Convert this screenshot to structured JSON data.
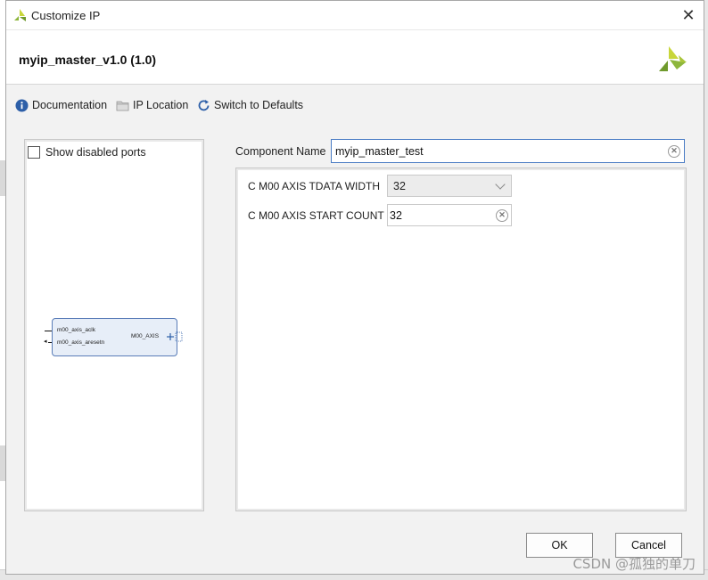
{
  "window": {
    "title": "Customize IP",
    "close_glyph": "✕"
  },
  "header": {
    "ip_title": "myip_master_v1.0 (1.0)",
    "brand_logo": "xilinx-logo"
  },
  "toolbar": {
    "documentation_label": "Documentation",
    "ip_location_label": "IP Location",
    "switch_defaults_label": "Switch to Defaults"
  },
  "symbol": {
    "show_disabled_ports_label": "Show disabled ports",
    "show_disabled_ports_checked": false,
    "ports_left": [
      "m00_axis_aclk",
      "m00_axis_aresetn"
    ],
    "port_right": "M00_AXIS"
  },
  "component": {
    "label": "Component Name",
    "value": "myip_master_test"
  },
  "params": [
    {
      "label": "C M00 AXIS TDATA WIDTH",
      "value": "32",
      "kind": "select"
    },
    {
      "label": "C M00 AXIS START COUNT",
      "value": "32",
      "kind": "input"
    }
  ],
  "buttons": {
    "ok": "OK",
    "cancel": "Cancel"
  },
  "watermark": "CSDN @孤独的单刀",
  "colors": {
    "accent_blue": "#4a7cc4",
    "ip_block_fill": "#e7eef8",
    "xilinx_green": "#8db63c"
  }
}
